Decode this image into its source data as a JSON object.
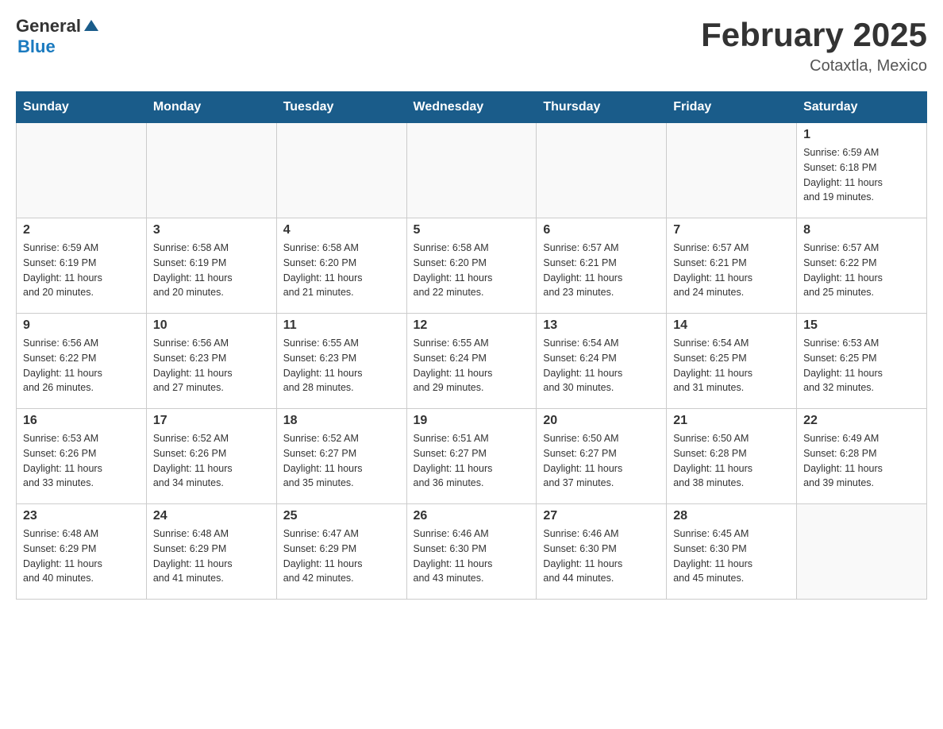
{
  "logo": {
    "general": "General",
    "arrow": "▲",
    "blue": "Blue"
  },
  "title": "February 2025",
  "subtitle": "Cotaxtla, Mexico",
  "weekdays": [
    "Sunday",
    "Monday",
    "Tuesday",
    "Wednesday",
    "Thursday",
    "Friday",
    "Saturday"
  ],
  "weeks": [
    [
      {
        "day": "",
        "info": ""
      },
      {
        "day": "",
        "info": ""
      },
      {
        "day": "",
        "info": ""
      },
      {
        "day": "",
        "info": ""
      },
      {
        "day": "",
        "info": ""
      },
      {
        "day": "",
        "info": ""
      },
      {
        "day": "1",
        "info": "Sunrise: 6:59 AM\nSunset: 6:18 PM\nDaylight: 11 hours\nand 19 minutes."
      }
    ],
    [
      {
        "day": "2",
        "info": "Sunrise: 6:59 AM\nSunset: 6:19 PM\nDaylight: 11 hours\nand 20 minutes."
      },
      {
        "day": "3",
        "info": "Sunrise: 6:58 AM\nSunset: 6:19 PM\nDaylight: 11 hours\nand 20 minutes."
      },
      {
        "day": "4",
        "info": "Sunrise: 6:58 AM\nSunset: 6:20 PM\nDaylight: 11 hours\nand 21 minutes."
      },
      {
        "day": "5",
        "info": "Sunrise: 6:58 AM\nSunset: 6:20 PM\nDaylight: 11 hours\nand 22 minutes."
      },
      {
        "day": "6",
        "info": "Sunrise: 6:57 AM\nSunset: 6:21 PM\nDaylight: 11 hours\nand 23 minutes."
      },
      {
        "day": "7",
        "info": "Sunrise: 6:57 AM\nSunset: 6:21 PM\nDaylight: 11 hours\nand 24 minutes."
      },
      {
        "day": "8",
        "info": "Sunrise: 6:57 AM\nSunset: 6:22 PM\nDaylight: 11 hours\nand 25 minutes."
      }
    ],
    [
      {
        "day": "9",
        "info": "Sunrise: 6:56 AM\nSunset: 6:22 PM\nDaylight: 11 hours\nand 26 minutes."
      },
      {
        "day": "10",
        "info": "Sunrise: 6:56 AM\nSunset: 6:23 PM\nDaylight: 11 hours\nand 27 minutes."
      },
      {
        "day": "11",
        "info": "Sunrise: 6:55 AM\nSunset: 6:23 PM\nDaylight: 11 hours\nand 28 minutes."
      },
      {
        "day": "12",
        "info": "Sunrise: 6:55 AM\nSunset: 6:24 PM\nDaylight: 11 hours\nand 29 minutes."
      },
      {
        "day": "13",
        "info": "Sunrise: 6:54 AM\nSunset: 6:24 PM\nDaylight: 11 hours\nand 30 minutes."
      },
      {
        "day": "14",
        "info": "Sunrise: 6:54 AM\nSunset: 6:25 PM\nDaylight: 11 hours\nand 31 minutes."
      },
      {
        "day": "15",
        "info": "Sunrise: 6:53 AM\nSunset: 6:25 PM\nDaylight: 11 hours\nand 32 minutes."
      }
    ],
    [
      {
        "day": "16",
        "info": "Sunrise: 6:53 AM\nSunset: 6:26 PM\nDaylight: 11 hours\nand 33 minutes."
      },
      {
        "day": "17",
        "info": "Sunrise: 6:52 AM\nSunset: 6:26 PM\nDaylight: 11 hours\nand 34 minutes."
      },
      {
        "day": "18",
        "info": "Sunrise: 6:52 AM\nSunset: 6:27 PM\nDaylight: 11 hours\nand 35 minutes."
      },
      {
        "day": "19",
        "info": "Sunrise: 6:51 AM\nSunset: 6:27 PM\nDaylight: 11 hours\nand 36 minutes."
      },
      {
        "day": "20",
        "info": "Sunrise: 6:50 AM\nSunset: 6:27 PM\nDaylight: 11 hours\nand 37 minutes."
      },
      {
        "day": "21",
        "info": "Sunrise: 6:50 AM\nSunset: 6:28 PM\nDaylight: 11 hours\nand 38 minutes."
      },
      {
        "day": "22",
        "info": "Sunrise: 6:49 AM\nSunset: 6:28 PM\nDaylight: 11 hours\nand 39 minutes."
      }
    ],
    [
      {
        "day": "23",
        "info": "Sunrise: 6:48 AM\nSunset: 6:29 PM\nDaylight: 11 hours\nand 40 minutes."
      },
      {
        "day": "24",
        "info": "Sunrise: 6:48 AM\nSunset: 6:29 PM\nDaylight: 11 hours\nand 41 minutes."
      },
      {
        "day": "25",
        "info": "Sunrise: 6:47 AM\nSunset: 6:29 PM\nDaylight: 11 hours\nand 42 minutes."
      },
      {
        "day": "26",
        "info": "Sunrise: 6:46 AM\nSunset: 6:30 PM\nDaylight: 11 hours\nand 43 minutes."
      },
      {
        "day": "27",
        "info": "Sunrise: 6:46 AM\nSunset: 6:30 PM\nDaylight: 11 hours\nand 44 minutes."
      },
      {
        "day": "28",
        "info": "Sunrise: 6:45 AM\nSunset: 6:30 PM\nDaylight: 11 hours\nand 45 minutes."
      },
      {
        "day": "",
        "info": ""
      }
    ]
  ]
}
